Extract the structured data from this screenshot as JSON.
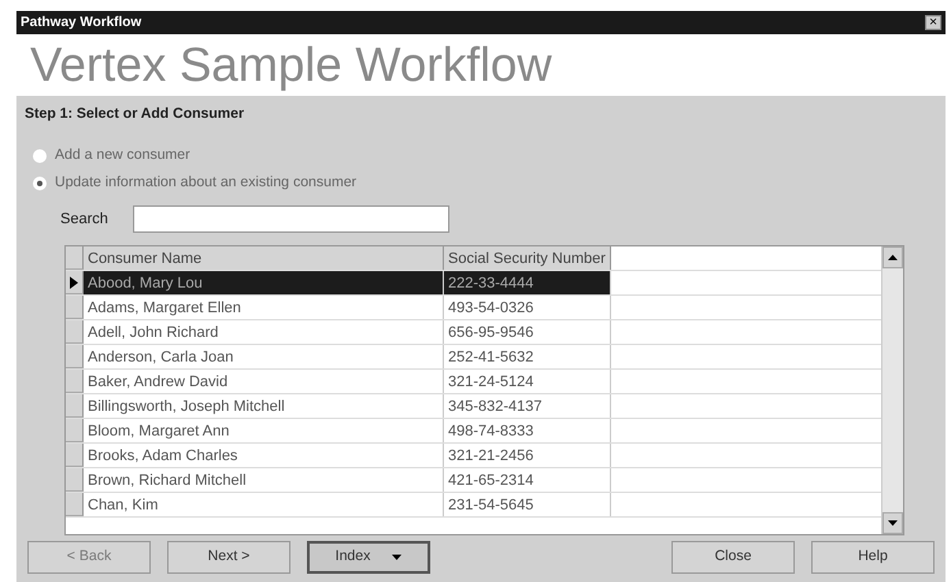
{
  "window": {
    "title": "Pathway Workflow",
    "close": "×"
  },
  "header": "Vertex Sample Workflow",
  "step": "Step 1: Select or Add Consumer",
  "options": [
    {
      "label": "Add a new consumer",
      "selected": false
    },
    {
      "label": "Update information about an existing consumer",
      "selected": true
    }
  ],
  "search": {
    "label": "Search"
  },
  "table": {
    "columns": [
      "Consumer Name",
      "Social Security Number"
    ],
    "rows": [
      {
        "cells": [
          "Abood, Mary Lou",
          "222-33-4444"
        ],
        "selected": true
      },
      {
        "cells": [
          "Adams, Margaret Ellen",
          "493-54-0326"
        ],
        "selected": false
      },
      {
        "cells": [
          "Adell, John Richard",
          "656-95-9546"
        ],
        "selected": false
      },
      {
        "cells": [
          "Anderson, Carla Joan",
          "252-41-5632"
        ],
        "selected": false
      },
      {
        "cells": [
          "Baker, Andrew David",
          "321-24-5124"
        ],
        "selected": false
      },
      {
        "cells": [
          "Billingsworth, Joseph Mitchell",
          "345-832-4137"
        ],
        "selected": false
      },
      {
        "cells": [
          "Bloom, Margaret Ann",
          "498-74-8333"
        ],
        "selected": false
      },
      {
        "cells": [
          "Brooks, Adam Charles",
          "321-21-2456"
        ],
        "selected": false
      },
      {
        "cells": [
          "Brown, Richard Mitchell",
          "421-65-2314"
        ],
        "selected": false
      },
      {
        "cells": [
          "Chan, Kim",
          "231-54-5645"
        ],
        "selected": false
      }
    ]
  },
  "buttons": [
    {
      "label": "< Back",
      "kind": "button",
      "disabled": true
    },
    {
      "label": "Next >",
      "kind": "button",
      "disabled": false
    },
    {
      "label": "Index",
      "kind": "dropdown",
      "disabled": false
    },
    {
      "label": "Close",
      "kind": "button",
      "disabled": false
    },
    {
      "label": "Help",
      "kind": "button",
      "disabled": false
    }
  ]
}
